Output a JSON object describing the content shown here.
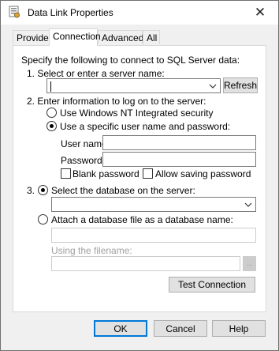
{
  "window": {
    "title": "Data Link Properties",
    "close_glyph": "✕"
  },
  "tabs": [
    {
      "label": "Provider",
      "active": false
    },
    {
      "label": "Connection",
      "active": true
    },
    {
      "label": "Advanced",
      "active": false
    },
    {
      "label": "All",
      "active": false
    }
  ],
  "connection": {
    "intro": "Specify the following to connect to SQL Server data:",
    "step1_label": "1. Select or enter a server name:",
    "server_value": "",
    "refresh_label": "Refresh",
    "step2_label": "2. Enter information to log on to the server:",
    "radio_windows_label": "Use Windows NT Integrated security",
    "radio_specific_label": "Use a specific user name and password:",
    "username_label": "User name:",
    "username_value": "",
    "password_label": "Password:",
    "password_value": "",
    "blank_password_label": "Blank password",
    "allow_saving_label": "Allow saving password",
    "step3_prefix": "3.",
    "radio_select_db_label": "Select the database on the server:",
    "database_value": "",
    "radio_attach_label": "Attach a database file as a database name:",
    "attach_name_value": "",
    "using_filename_label": "Using the filename:",
    "filename_value": "",
    "browse_label": "...",
    "test_connection_label": "Test Connection"
  },
  "footer": {
    "ok_label": "OK",
    "cancel_label": "Cancel",
    "help_label": "Help"
  },
  "colors": {
    "accent": "#0078d7",
    "disabled_text": "#a0a0a0"
  }
}
